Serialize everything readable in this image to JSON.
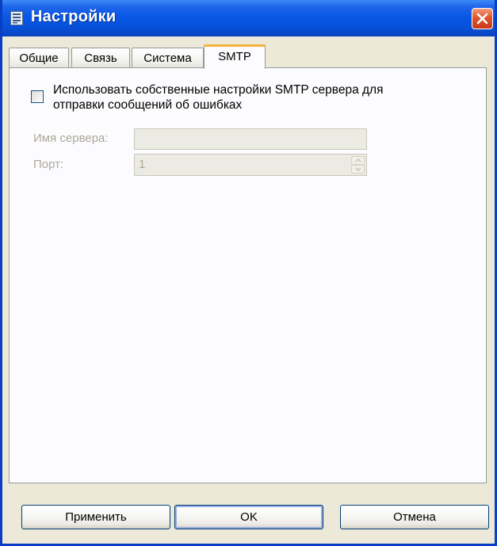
{
  "window": {
    "title": "Настройки"
  },
  "tabs": [
    {
      "label": "Общие",
      "active": false
    },
    {
      "label": "Связь",
      "active": false
    },
    {
      "label": "Система",
      "active": false
    },
    {
      "label": "SMTP",
      "active": true
    }
  ],
  "smtp": {
    "use_custom_label": "Использовать собственные настройки SMTP сервера для отправки сообщений об ошибках",
    "use_custom_checked": false,
    "server_label": "Имя сервера:",
    "server_value": "",
    "port_label": "Порт:",
    "port_value": "1"
  },
  "buttons": {
    "apply": "Применить",
    "ok": "OK",
    "cancel": "Отмена"
  },
  "colors": {
    "titlebar": "#0a57e6",
    "window_border": "#0a3fc4",
    "dialog_background": "#ece9d8",
    "active_tab_highlight": "#f4b43a",
    "close_button": "#e0552d",
    "disabled_text": "#aca899"
  }
}
